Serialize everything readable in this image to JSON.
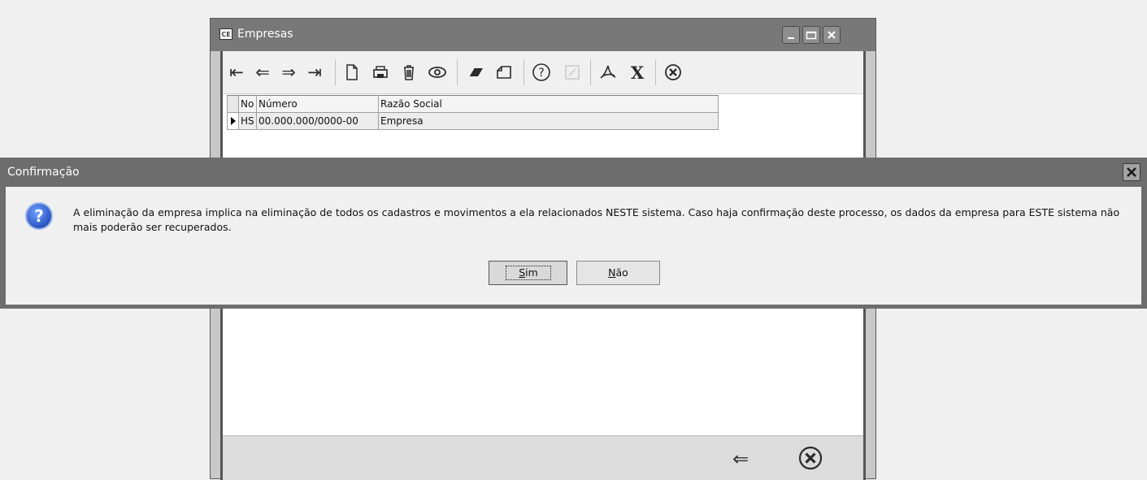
{
  "window": {
    "app_icon_text": "CE",
    "title": "Empresas",
    "controls": {
      "minimize": "minimize",
      "maximize": "maximize",
      "close": "close"
    }
  },
  "toolbar": {
    "items": [
      {
        "icon": "first-record-icon",
        "glyph": "⇤"
      },
      {
        "icon": "previous-record-icon",
        "glyph": "⇐"
      },
      {
        "icon": "next-record-icon",
        "glyph": "⇒"
      },
      {
        "icon": "last-record-icon",
        "glyph": "⇥"
      },
      {
        "icon": "new-document-icon"
      },
      {
        "icon": "printer-icon"
      },
      {
        "icon": "trash-icon"
      },
      {
        "icon": "eye-icon"
      },
      {
        "icon": "eraser-icon"
      },
      {
        "icon": "folder-icon"
      },
      {
        "icon": "help-icon"
      },
      {
        "icon": "edit-disabled-icon"
      },
      {
        "icon": "pdf-icon"
      },
      {
        "icon": "excel-icon",
        "glyph": "X"
      },
      {
        "icon": "close-circle-icon",
        "glyph": "✖"
      }
    ]
  },
  "grid": {
    "columns": [
      "No",
      "Número",
      "Razão Social"
    ],
    "rows": [
      {
        "no": "HS",
        "numero": "00.000.000/0000-00",
        "razao_social": "Empresa"
      }
    ]
  },
  "footer": {
    "back_icon": "back-arrow-icon",
    "back_glyph": "⇐",
    "close_icon": "close-circle-icon"
  },
  "dialog": {
    "title": "Confirmação",
    "close_icon": "close-icon",
    "icon": "question-icon",
    "message": "A eliminação da empresa implica na eliminação de todos os cadastros e movimentos a ela relacionados NESTE sistema. Caso haja confirmação deste processo, os dados da empresa para ESTE sistema não mais poderão ser recuperados.",
    "yes_button": {
      "mnemonic": "S",
      "rest": "im"
    },
    "no_button": {
      "mnemonic": "N",
      "rest": "ão"
    }
  },
  "colors": {
    "title_bar": "#787878",
    "dialog_frame": "#6d6d6d",
    "dialog_body": "#f0f0f0",
    "question_icon": "#2a5cc6"
  }
}
